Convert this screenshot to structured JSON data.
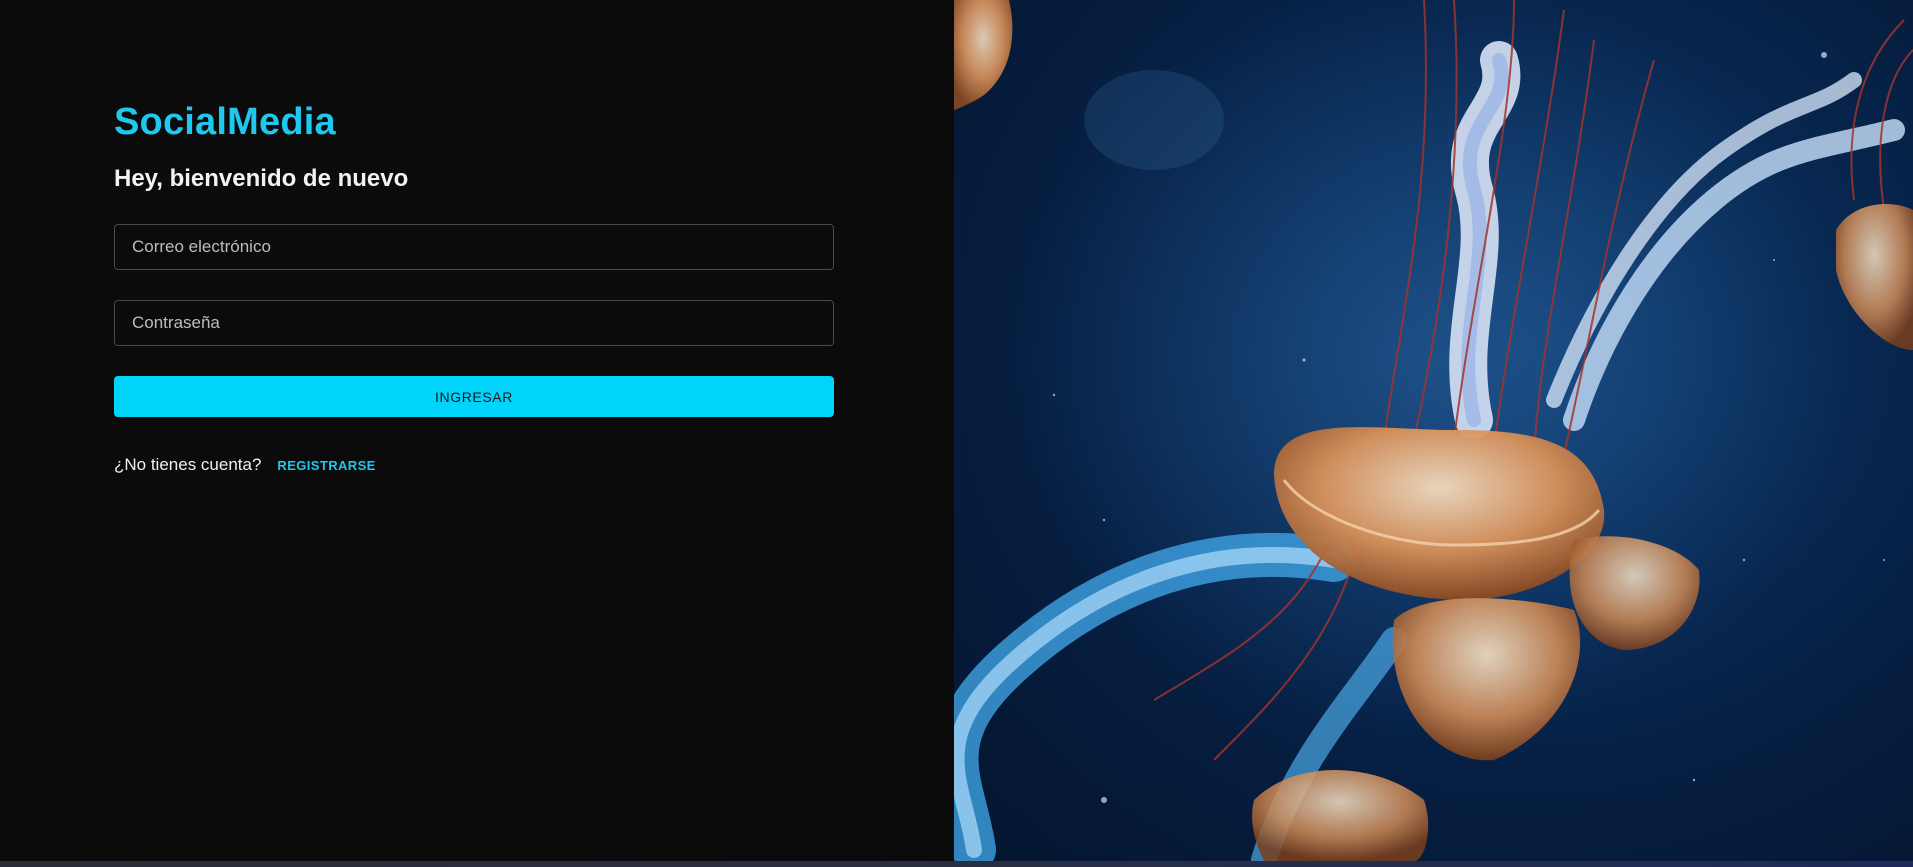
{
  "brand": {
    "name": "SocialMedia"
  },
  "login": {
    "welcome": "Hey, bienvenido de nuevo",
    "email_placeholder": "Correo electrónico",
    "password_placeholder": "Contraseña",
    "submit_label": "INGRESAR",
    "no_account_text": "¿No tienes cuenta?",
    "register_label": "REGISTRARSE"
  },
  "hero_image": {
    "subject": "jellyfish in deep blue water"
  },
  "colors": {
    "accent": "#1ec8ee",
    "button": "#00d4fb",
    "background": "#0b0b0b",
    "ocean": "#082a55",
    "jelly": "#d9925a"
  }
}
